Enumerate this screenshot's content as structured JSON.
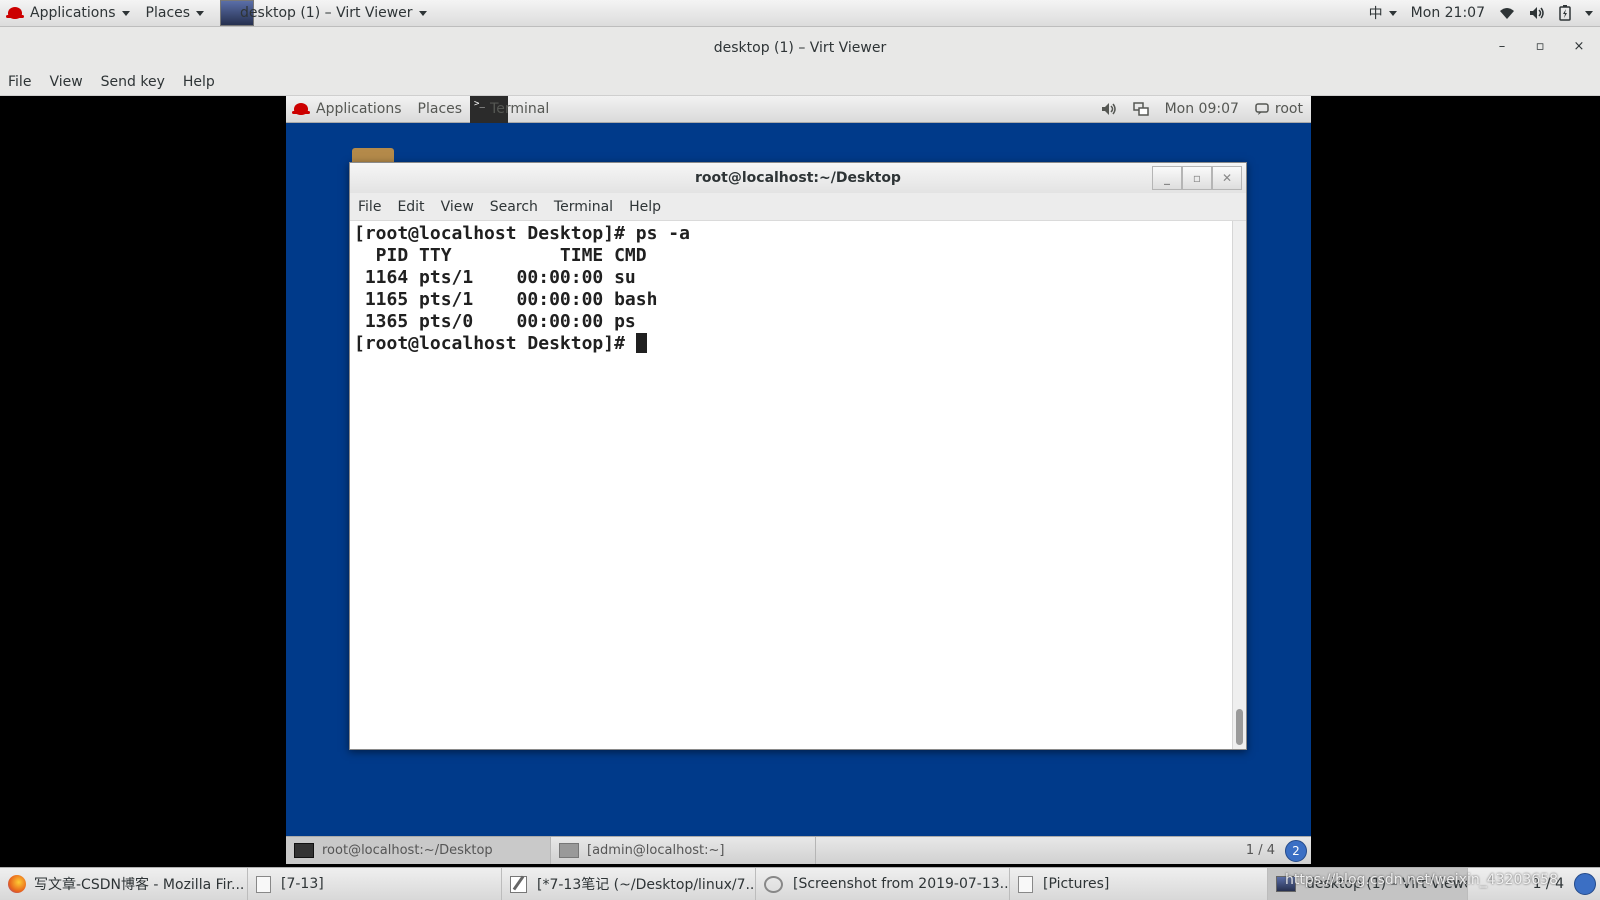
{
  "host_panel": {
    "applications": "Applications",
    "places": "Places",
    "active_window": "desktop (1) – Virt Viewer",
    "input_method": "中",
    "clock": "Mon 21:07"
  },
  "virt_viewer": {
    "title": "desktop (1) – Virt Viewer",
    "menu": [
      "File",
      "View",
      "Send key",
      "Help"
    ],
    "controls": {
      "minimize": "–",
      "maximize": "▫",
      "close": "×"
    }
  },
  "guest_panel": {
    "applications": "Applications",
    "places": "Places",
    "active_app": "Terminal",
    "clock": "Mon 09:07",
    "user": "root"
  },
  "terminal": {
    "title": "root@localhost:~/Desktop",
    "menu": [
      "File",
      "Edit",
      "View",
      "Search",
      "Terminal",
      "Help"
    ],
    "lines": [
      "[root@localhost Desktop]# ps -a",
      "  PID TTY          TIME CMD",
      " 1164 pts/1    00:00:00 su",
      " 1165 pts/1    00:00:00 bash",
      " 1365 pts/0    00:00:00 ps"
    ],
    "prompt": "[root@localhost Desktop]# "
  },
  "guest_taskbar": {
    "tasks": [
      "root@localhost:~/Desktop",
      "[admin@localhost:~]"
    ],
    "workspace": "1 / 4",
    "workspace_badge": "2"
  },
  "host_taskbar": {
    "tasks": [
      "写文章-CSDN博客 - Mozilla Fir...",
      "[7-13]",
      "[*7-13笔记 (~/Desktop/linux/7...",
      "[Screenshot from 2019-07-13...",
      "[Pictures]",
      "desktop (1) – Virt Viewer"
    ],
    "workspace": "1 / 4",
    "watermark": "https://blog.csdn.net/weixin_43203658"
  }
}
